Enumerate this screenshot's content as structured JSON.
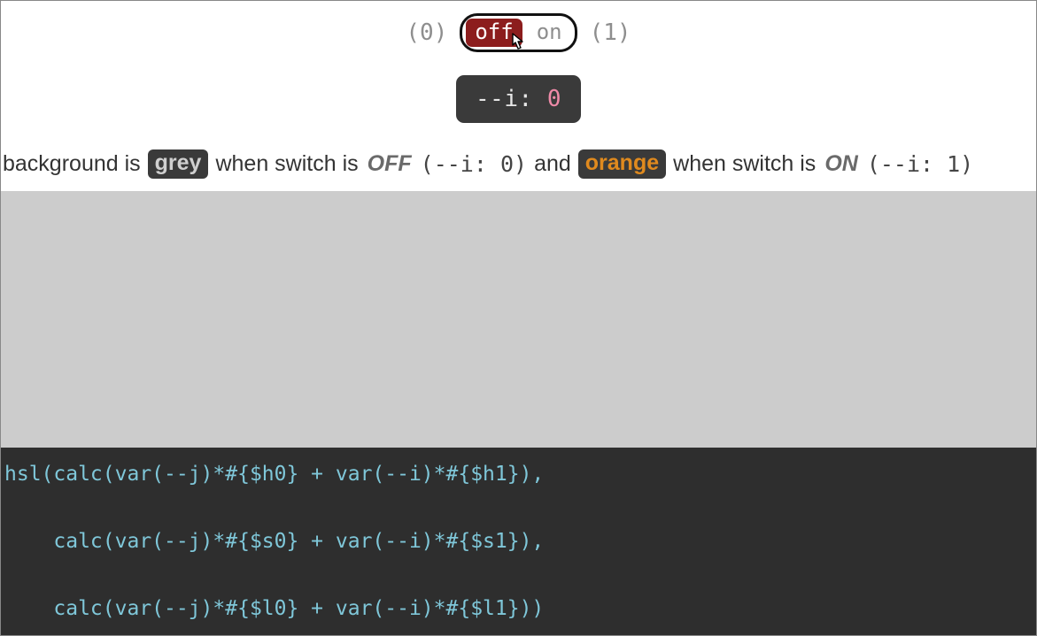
{
  "switch": {
    "hint_off": "(0)",
    "hint_on": "(1)",
    "label_off": "off",
    "label_on": "on"
  },
  "var_badge": {
    "name": "--i:",
    "value": "0"
  },
  "sentence": {
    "t1": "background is",
    "grey_label": "grey",
    "t2": "when switch is",
    "state_off": "OFF",
    "paren_off": "(--i: 0)",
    "t3": "and",
    "orange_label": "orange",
    "t4": "when switch is",
    "state_on": "ON",
    "paren_on": "(--i: 1)"
  },
  "code": {
    "line1": "hsl(calc(var(--j)*#{$h0} + var(--i)*#{$h1}),",
    "line2": "    calc(var(--j)*#{$s0} + var(--i)*#{$s1}),",
    "line3": "    calc(var(--j)*#{$l0} + var(--i)*#{$l1}))"
  }
}
